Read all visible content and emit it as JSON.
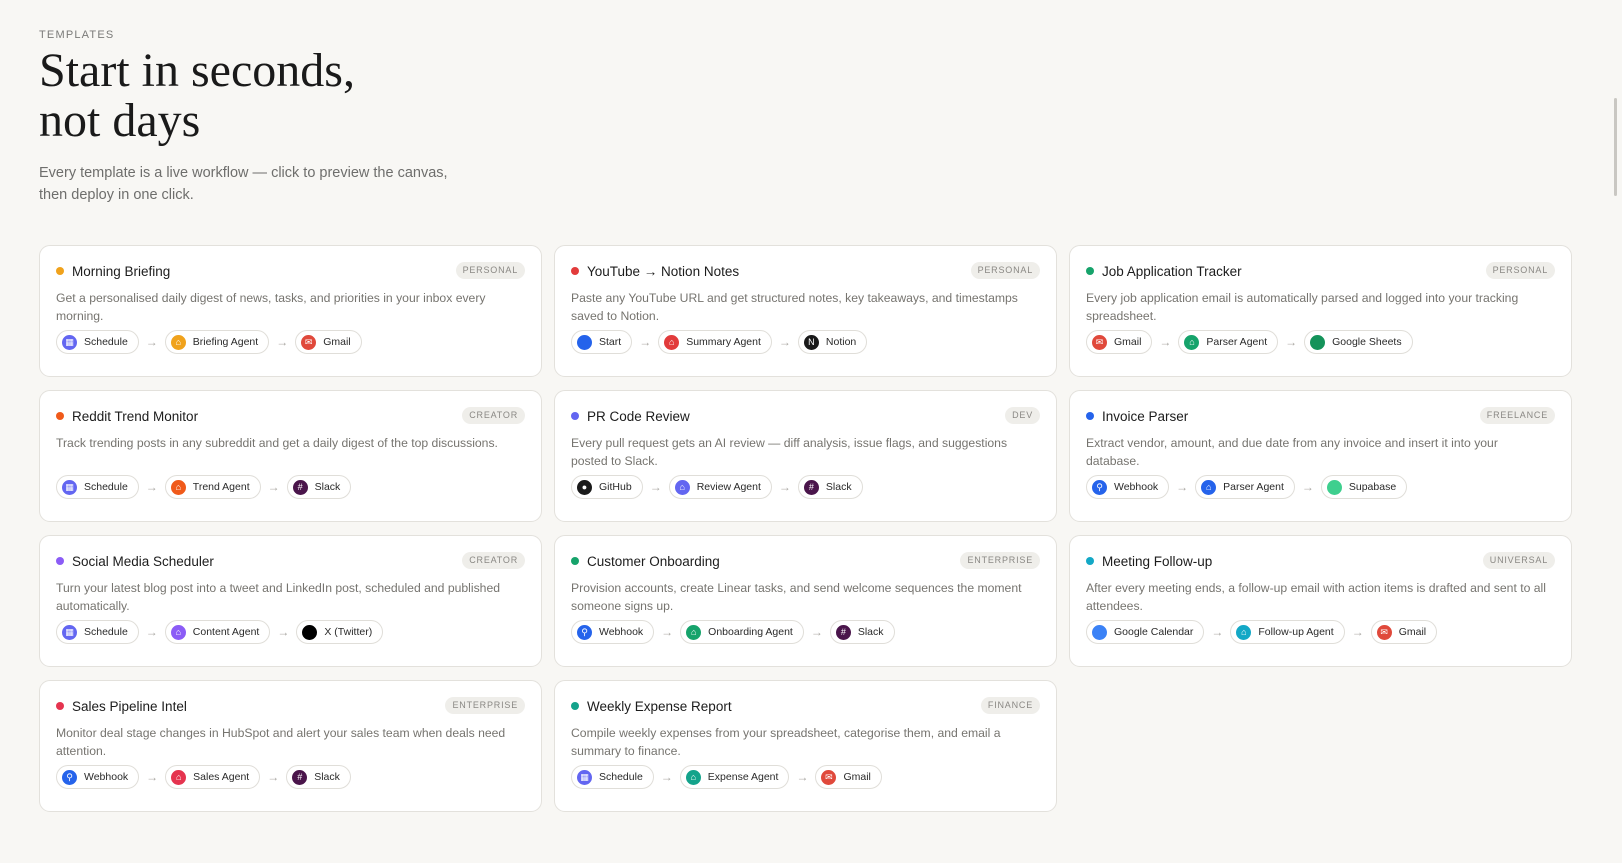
{
  "header": {
    "eyebrow": "TEMPLATES",
    "title_line1": "Start in seconds,",
    "title_line2": "not days",
    "subtitle_line1": "Every template is a live workflow — click to preview the canvas,",
    "subtitle_line2": "then deploy in one click."
  },
  "templates": [
    {
      "title": "Morning Briefing",
      "tag": "PERSONAL",
      "dot": "#f0a21c",
      "desc": "Get a personalised daily digest of news, tasks, and priorities in your inbox every morning.",
      "steps": [
        {
          "label": "Schedule",
          "icon": "calendar-icon",
          "color": "#6366f1",
          "glyph": "▦"
        },
        {
          "label": "Briefing Agent",
          "icon": "robot-icon",
          "color": "#f0a21c",
          "glyph": "⌂"
        },
        {
          "label": "Gmail",
          "icon": "gmail-icon",
          "color": "#e0493b",
          "glyph": "✉"
        }
      ]
    },
    {
      "title": "YouTube → Notion Notes",
      "tag": "PERSONAL",
      "dot": "#e23b3b",
      "desc": "Paste any YouTube URL and get structured notes, key takeaways, and timestamps saved to Notion.",
      "steps": [
        {
          "label": "Start",
          "icon": "start-icon",
          "color": "#2563eb",
          "glyph": ""
        },
        {
          "label": "Summary Agent",
          "icon": "robot-icon",
          "color": "#e23b3b",
          "glyph": "⌂"
        },
        {
          "label": "Notion",
          "icon": "notion-icon",
          "color": "#1a1a1a",
          "glyph": "N"
        }
      ]
    },
    {
      "title": "Job Application Tracker",
      "tag": "PERSONAL",
      "dot": "#16a36b",
      "desc": "Every job application email is automatically parsed and logged into your tracking spreadsheet.",
      "steps": [
        {
          "label": "Gmail",
          "icon": "gmail-icon",
          "color": "#e0493b",
          "glyph": "✉"
        },
        {
          "label": "Parser Agent",
          "icon": "robot-icon",
          "color": "#16a36b",
          "glyph": "⌂"
        },
        {
          "label": "Google Sheets",
          "icon": "sheets-icon",
          "color": "#14935a",
          "glyph": ""
        }
      ]
    },
    {
      "title": "Reddit Trend Monitor",
      "tag": "CREATOR",
      "dot": "#f05a1a",
      "desc": "Track trending posts in any subreddit and get a daily digest of the top discussions.",
      "steps": [
        {
          "label": "Schedule",
          "icon": "calendar-icon",
          "color": "#6366f1",
          "glyph": "▦"
        },
        {
          "label": "Trend Agent",
          "icon": "robot-icon",
          "color": "#f05a1a",
          "glyph": "⌂"
        },
        {
          "label": "Slack",
          "icon": "slack-icon",
          "color": "#4a154b",
          "glyph": "#"
        }
      ]
    },
    {
      "title": "PR Code Review",
      "tag": "DEV",
      "dot": "#6366f1",
      "desc": "Every pull request gets an AI review — diff analysis, issue flags, and suggestions posted to Slack.",
      "steps": [
        {
          "label": "GitHub",
          "icon": "github-icon",
          "color": "#1a1a1a",
          "glyph": "●"
        },
        {
          "label": "Review Agent",
          "icon": "robot-icon",
          "color": "#6366f1",
          "glyph": "⌂"
        },
        {
          "label": "Slack",
          "icon": "slack-icon",
          "color": "#4a154b",
          "glyph": "#"
        }
      ]
    },
    {
      "title": "Invoice Parser",
      "tag": "FREELANCE",
      "dot": "#2563eb",
      "desc": "Extract vendor, amount, and due date from any invoice and insert it into your database.",
      "steps": [
        {
          "label": "Webhook",
          "icon": "webhook-icon",
          "color": "#2563eb",
          "glyph": "⚲"
        },
        {
          "label": "Parser Agent",
          "icon": "robot-icon",
          "color": "#2563eb",
          "glyph": "⌂"
        },
        {
          "label": "Supabase",
          "icon": "supabase-icon",
          "color": "#3ecf8e",
          "glyph": ""
        }
      ]
    },
    {
      "title": "Social Media Scheduler",
      "tag": "CREATOR",
      "dot": "#8b5cf6",
      "desc": "Turn your latest blog post into a tweet and LinkedIn post, scheduled and published automatically.",
      "steps": [
        {
          "label": "Schedule",
          "icon": "calendar-icon",
          "color": "#6366f1",
          "glyph": "▦"
        },
        {
          "label": "Content Agent",
          "icon": "robot-icon",
          "color": "#8b5cf6",
          "glyph": "⌂"
        },
        {
          "label": "X (Twitter)",
          "icon": "x-twitter-icon",
          "color": "#000000",
          "glyph": ""
        }
      ]
    },
    {
      "title": "Customer Onboarding",
      "tag": "ENTERPRISE",
      "dot": "#16a36b",
      "desc": "Provision accounts, create Linear tasks, and send welcome sequences the moment someone signs up.",
      "steps": [
        {
          "label": "Webhook",
          "icon": "webhook-icon",
          "color": "#2563eb",
          "glyph": "⚲"
        },
        {
          "label": "Onboarding Agent",
          "icon": "robot-icon",
          "color": "#16a36b",
          "glyph": "⌂"
        },
        {
          "label": "Slack",
          "icon": "slack-icon",
          "color": "#4a154b",
          "glyph": "#"
        }
      ]
    },
    {
      "title": "Meeting Follow-up",
      "tag": "UNIVERSAL",
      "dot": "#13a8c6",
      "desc": "After every meeting ends, a follow-up email with action items is drafted and sent to all attendees.",
      "steps": [
        {
          "label": "Google Calendar",
          "icon": "google-calendar-icon",
          "color": "#3b82f6",
          "glyph": ""
        },
        {
          "label": "Follow-up Agent",
          "icon": "robot-icon",
          "color": "#13a8c6",
          "glyph": "⌂"
        },
        {
          "label": "Gmail",
          "icon": "gmail-icon",
          "color": "#e0493b",
          "glyph": "✉"
        }
      ]
    },
    {
      "title": "Sales Pipeline Intel",
      "tag": "ENTERPRISE",
      "dot": "#e5344f",
      "desc": "Monitor deal stage changes in HubSpot and alert your sales team when deals need attention.",
      "steps": [
        {
          "label": "Webhook",
          "icon": "webhook-icon",
          "color": "#2563eb",
          "glyph": "⚲"
        },
        {
          "label": "Sales Agent",
          "icon": "robot-icon",
          "color": "#e5344f",
          "glyph": "⌂"
        },
        {
          "label": "Slack",
          "icon": "slack-icon",
          "color": "#4a154b",
          "glyph": "#"
        }
      ]
    },
    {
      "title": "Weekly Expense Report",
      "tag": "FINANCE",
      "dot": "#14a38b",
      "desc": "Compile weekly expenses from your spreadsheet, categorise them, and email a summary to finance.",
      "steps": [
        {
          "label": "Schedule",
          "icon": "calendar-icon",
          "color": "#6366f1",
          "glyph": "▦"
        },
        {
          "label": "Expense Agent",
          "icon": "robot-icon",
          "color": "#14a38b",
          "glyph": "⌂"
        },
        {
          "label": "Gmail",
          "icon": "gmail-icon",
          "color": "#e0493b",
          "glyph": "✉"
        }
      ]
    }
  ]
}
